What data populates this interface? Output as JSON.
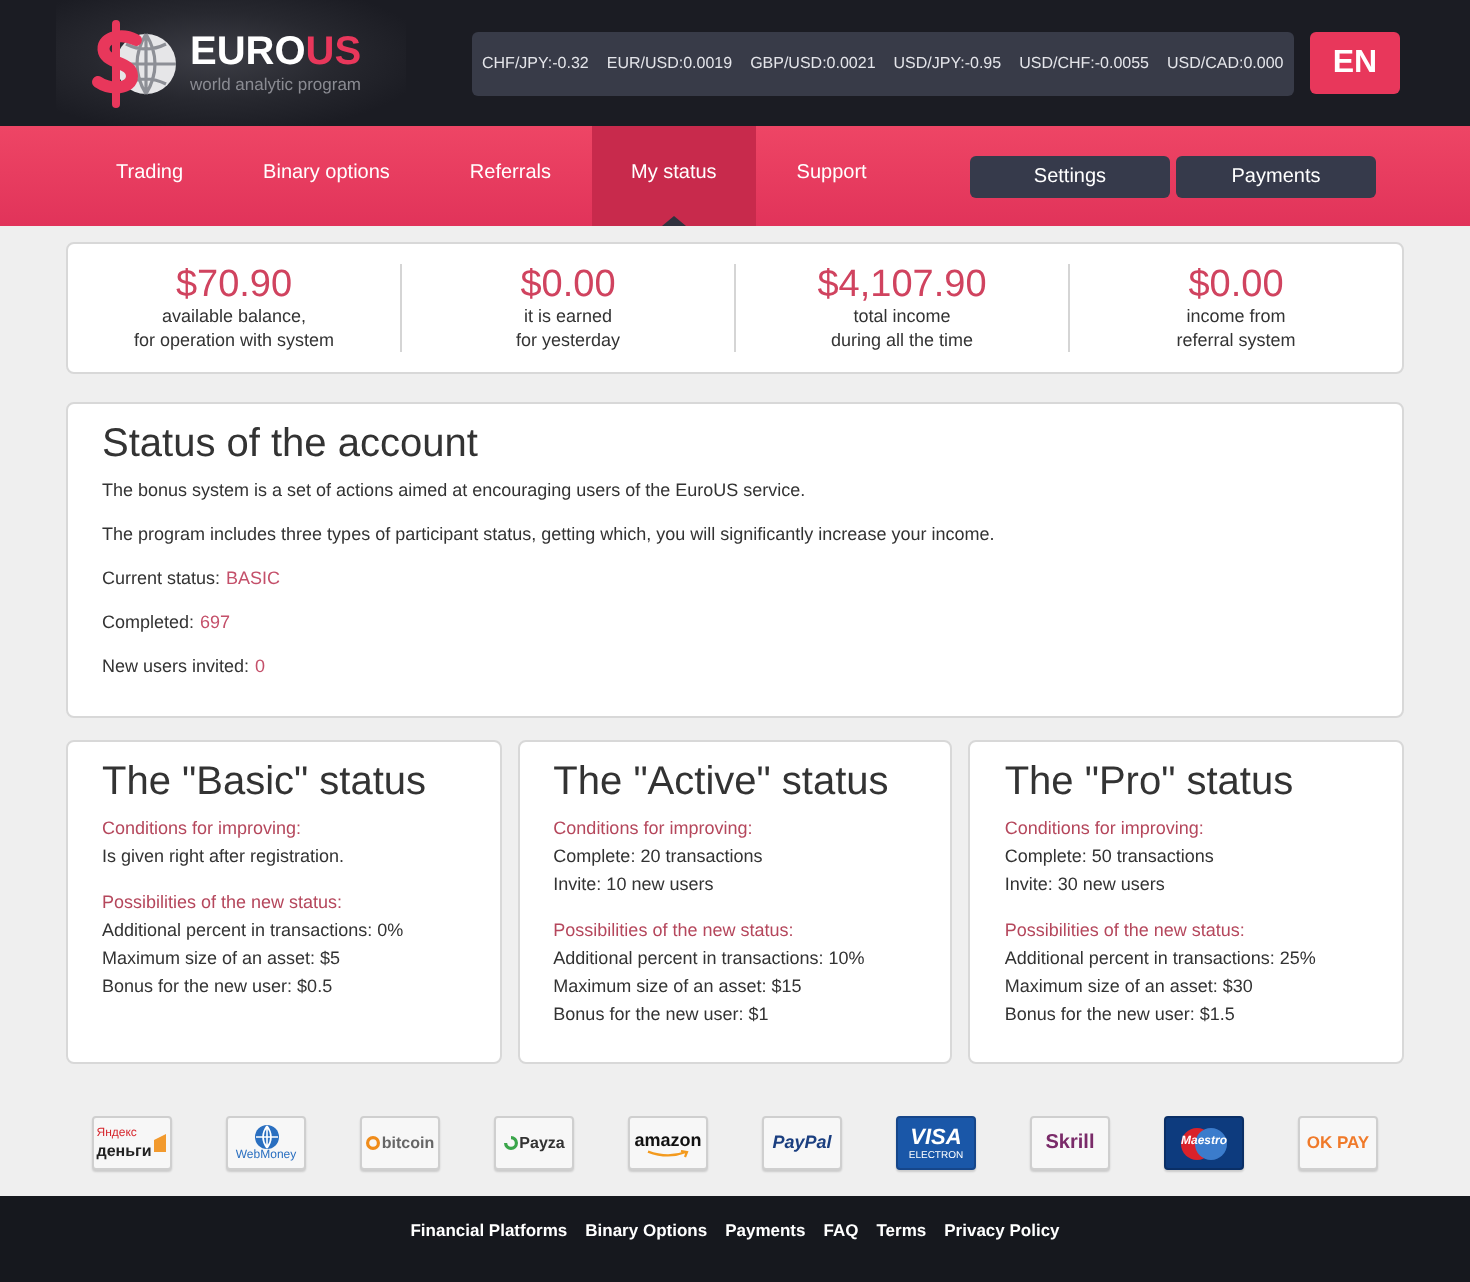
{
  "header": {
    "logo": {
      "brand_main": "EURO",
      "brand_accent": "US",
      "tagline": "world analytic program"
    },
    "ticker": [
      "CHF/JPY:-0.32",
      "EUR/USD:0.0019",
      "GBP/USD:0.0021",
      "USD/JPY:-0.95",
      "USD/CHF:-0.0055",
      "USD/CAD:0.000"
    ],
    "language_button": "EN"
  },
  "nav": {
    "tabs": [
      {
        "label": "Trading",
        "selected": false
      },
      {
        "label": "Binary options",
        "selected": false
      },
      {
        "label": "Referrals",
        "selected": false
      },
      {
        "label": "My status",
        "selected": true
      },
      {
        "label": "Support",
        "selected": false
      }
    ],
    "buttons": [
      "Settings",
      "Payments"
    ]
  },
  "stats": [
    {
      "amount": "$70.90",
      "caption": [
        "available balance,",
        "for operation with system"
      ]
    },
    {
      "amount": "$0.00",
      "caption": [
        "it is earned",
        "for yesterday"
      ]
    },
    {
      "amount": "$4,107.90",
      "caption": [
        "total income",
        "during all the time"
      ]
    },
    {
      "amount": "$0.00",
      "caption": [
        "income from",
        "referral system"
      ]
    }
  ],
  "account_status": {
    "title": "Status of the account",
    "paragraphs": [
      "The bonus system is a set of actions aimed at encouraging users of the EuroUS service.",
      "The program includes three types of participant status, getting which, you will significantly increase your income."
    ],
    "facts": [
      {
        "label": "Current status:",
        "value": "BASIC"
      },
      {
        "label": "Completed:",
        "value": "697"
      },
      {
        "label": "New users invited:",
        "value": "0"
      }
    ]
  },
  "status_cards": [
    {
      "title": "The \"Basic\" status",
      "conditions_heading": "Conditions for improving:",
      "conditions": [
        "Is given right after registration."
      ],
      "possibilities_heading": "Possibilities of the new status:",
      "possibilities": [
        "Additional percent in transactions: 0%",
        "Maximum size of an asset: $5",
        "Bonus for the new user: $0.5"
      ]
    },
    {
      "title": "The \"Active\" status",
      "conditions_heading": "Conditions for improving:",
      "conditions": [
        "Complete: 20 transactions",
        "Invite: 10 new users"
      ],
      "possibilities_heading": "Possibilities of the new status:",
      "possibilities": [
        "Additional percent in transactions: 10%",
        "Maximum size of an asset: $15",
        "Bonus for the new user: $1"
      ]
    },
    {
      "title": "The \"Pro\" status",
      "conditions_heading": "Conditions for improving:",
      "conditions": [
        "Complete: 50 transactions",
        "Invite: 30 new users"
      ],
      "possibilities_heading": "Possibilities of the new status:",
      "possibilities": [
        "Additional percent in transactions: 25%",
        "Maximum size of an asset: $30",
        "Bonus for the new user: $1.5"
      ]
    }
  ],
  "payment_logos": [
    {
      "kind": "yandex",
      "small_text": "Яндекс",
      "text": "деньги"
    },
    {
      "kind": "webmoney",
      "text": "WebMoney"
    },
    {
      "kind": "bitcoin",
      "text": "bitcoin"
    },
    {
      "kind": "payza",
      "text": "Payza"
    },
    {
      "kind": "amazon",
      "text": "amazon"
    },
    {
      "kind": "paypal",
      "text": "PayPal"
    },
    {
      "kind": "visa",
      "text": "VISA",
      "small_text": "ELECTRON"
    },
    {
      "kind": "skrill",
      "text": "Skrill"
    },
    {
      "kind": "maestro",
      "text": "Maestro"
    },
    {
      "kind": "okpay",
      "text": "OK PAY"
    }
  ],
  "footer": {
    "links": [
      "Financial Platforms",
      "Binary Options",
      "Payments",
      "FAQ",
      "Terms",
      "Privacy Policy"
    ]
  }
}
